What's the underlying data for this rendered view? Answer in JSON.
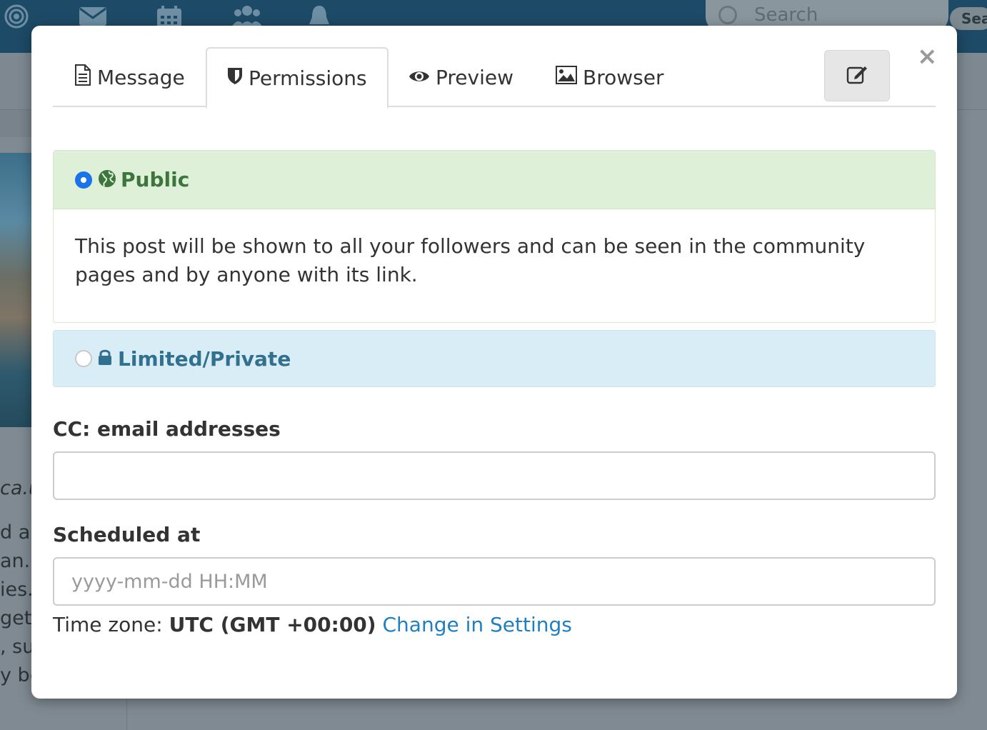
{
  "background": {
    "nav_icons": [
      "target-icon",
      "envelope-icon",
      "calendar-icon",
      "users-icon",
      "bell-icon"
    ],
    "search_placeholder": "Search",
    "search_button_label": "Sea",
    "side_text": [
      "ca.u",
      "d all",
      "an.",
      "ies.",
      "get",
      ", su",
      "y be"
    ]
  },
  "modal": {
    "tabs": [
      {
        "label": "Message",
        "icon": "file-icon"
      },
      {
        "label": "Permissions",
        "icon": "shield-icon",
        "active": true
      },
      {
        "label": "Preview",
        "icon": "eye-icon"
      },
      {
        "label": "Browser",
        "icon": "image-icon"
      }
    ],
    "close_symbol": "×",
    "edit_icon": "edit-icon",
    "public": {
      "label": "Public",
      "selected": true,
      "description": "This post will be shown to all your followers and can be seen in the community pages and by anyone with its link."
    },
    "private": {
      "label": "Limited/Private",
      "selected": false
    },
    "cc": {
      "label": "CC: email addresses",
      "value": "",
      "placeholder": ""
    },
    "scheduled": {
      "label": "Scheduled at",
      "value": "",
      "placeholder": "yyyy-mm-dd HH:MM"
    },
    "timezone": {
      "prefix": "Time zone:",
      "value": "UTC (GMT +00:00)",
      "link": "Change in Settings"
    }
  },
  "colors": {
    "topbar": "#1d4a66",
    "public_bg": "#dff0d8",
    "public_text": "#3c763d",
    "private_bg": "#d9edf7",
    "private_text": "#31708f",
    "link": "#1f7fc1",
    "radio_selected": "#1a73e8"
  }
}
